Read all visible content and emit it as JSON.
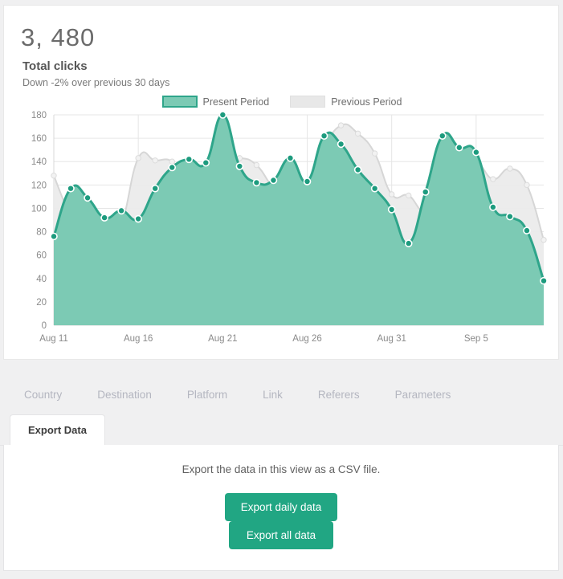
{
  "stat": {
    "value": "3, 480",
    "title": "Total clicks",
    "subtitle": "Down -2% over previous 30 days"
  },
  "legend": {
    "present_label": "Present Period",
    "previous_label": "Previous Period",
    "present_color": "#7ccab4",
    "present_stroke": "#2ea58a",
    "previous_color": "#e8e8e8"
  },
  "tabs": [
    {
      "label": "Country"
    },
    {
      "label": "Destination"
    },
    {
      "label": "Platform"
    },
    {
      "label": "Link"
    },
    {
      "label": "Referers"
    },
    {
      "label": "Parameters"
    }
  ],
  "subtab": {
    "label": "Export Data"
  },
  "export": {
    "description": "Export the data in this view as a CSV file.",
    "daily_button": "Export daily data",
    "all_button": "Export all data",
    "button_color": "#21a683"
  },
  "chart_data": {
    "type": "area",
    "title": "Total clicks",
    "xlabel": "",
    "ylabel": "",
    "ylim": [
      0,
      180
    ],
    "yticks": [
      0,
      20,
      40,
      60,
      80,
      100,
      120,
      140,
      160,
      180
    ],
    "xtick_labels": [
      "Aug 11",
      "Aug 16",
      "Aug 21",
      "Aug 26",
      "Aug 31",
      "Sep 5"
    ],
    "xtick_indices": [
      0,
      5,
      10,
      15,
      20,
      25
    ],
    "grid": true,
    "legend_position": "top-center",
    "x": [
      "Aug 11",
      "Aug 12",
      "Aug 13",
      "Aug 14",
      "Aug 15",
      "Aug 16",
      "Aug 17",
      "Aug 18",
      "Aug 19",
      "Aug 20",
      "Aug 21",
      "Aug 22",
      "Aug 23",
      "Aug 24",
      "Aug 25",
      "Aug 26",
      "Aug 27",
      "Aug 28",
      "Aug 29",
      "Aug 30",
      "Aug 31",
      "Sep 1",
      "Sep 2",
      "Sep 3",
      "Sep 4",
      "Sep 5",
      "Sep 6",
      "Sep 7",
      "Sep 8",
      "Sep 9"
    ],
    "series": [
      {
        "name": "Present Period",
        "color": "#2ea58a",
        "fill": "#7ccab4",
        "values": [
          76,
          117,
          109,
          92,
          98,
          91,
          117,
          135,
          142,
          139,
          180,
          136,
          122,
          124,
          143,
          123,
          162,
          155,
          133,
          117,
          99,
          70,
          114,
          162,
          152,
          148,
          101,
          93,
          81,
          38
        ]
      },
      {
        "name": "Previous Period",
        "color": "#d6d6d6",
        "fill": "#ebebeb",
        "values": [
          128,
          94,
          78,
          67,
          86,
          143,
          141,
          140,
          122,
          104,
          139,
          143,
          137,
          117,
          103,
          102,
          149,
          171,
          164,
          147,
          112,
          111,
          97,
          116,
          127,
          139,
          125,
          134,
          120,
          73
        ]
      }
    ]
  }
}
